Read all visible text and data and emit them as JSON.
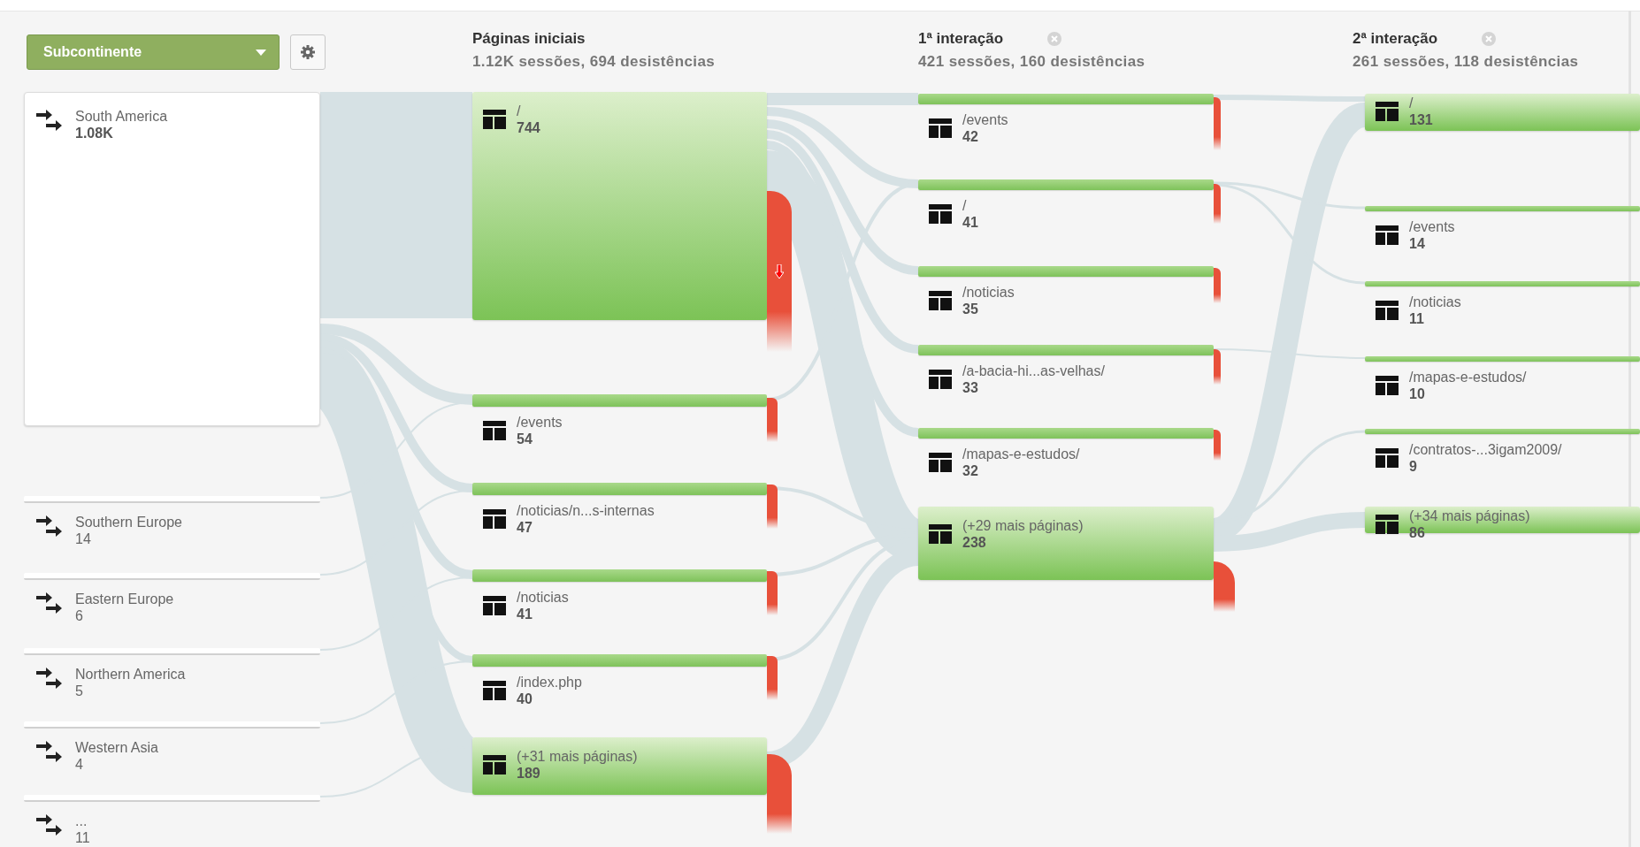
{
  "dimension_selector": {
    "value": "Subcontinente"
  },
  "sources": [
    {
      "name": "South America",
      "count": "1.08K"
    },
    {
      "name": "Southern Europe",
      "count": "14"
    },
    {
      "name": "Eastern Europe",
      "count": "6"
    },
    {
      "name": "Northern America",
      "count": "5"
    },
    {
      "name": "Western Asia",
      "count": "4"
    },
    {
      "name": "...",
      "count": "11"
    }
  ],
  "steps": [
    {
      "title": "Páginas iniciais",
      "summary": "1.12K sessões, 694 desistências",
      "closable": false,
      "nodes": [
        {
          "page": "/",
          "count": "744"
        },
        {
          "page": "/events",
          "count": "54"
        },
        {
          "page": "/noticias/n...s-internas",
          "count": "47"
        },
        {
          "page": "/noticias",
          "count": "41"
        },
        {
          "page": "/index.php",
          "count": "40"
        },
        {
          "page": "(+31 mais páginas)",
          "count": "189"
        }
      ]
    },
    {
      "title": "1ª interação",
      "summary": "421 sessões, 160 desistências",
      "closable": true,
      "nodes": [
        {
          "page": "/events",
          "count": "42"
        },
        {
          "page": "/",
          "count": "41"
        },
        {
          "page": "/noticias",
          "count": "35"
        },
        {
          "page": "/a-bacia-hi...as-velhas/",
          "count": "33"
        },
        {
          "page": "/mapas-e-estudos/",
          "count": "32"
        },
        {
          "page": "(+29 mais páginas)",
          "count": "238"
        }
      ]
    },
    {
      "title": "2ª interação",
      "summary": "261 sessões, 118 desistências",
      "closable": true,
      "nodes": [
        {
          "page": "/",
          "count": "131"
        },
        {
          "page": "/events",
          "count": "14"
        },
        {
          "page": "/noticias",
          "count": "11"
        },
        {
          "page": "/mapas-e-estudos/",
          "count": "10"
        },
        {
          "page": "/contratos-...3igam2009/",
          "count": "9"
        },
        {
          "page": "(+34 mais páginas)",
          "count": "86"
        }
      ]
    }
  ]
}
